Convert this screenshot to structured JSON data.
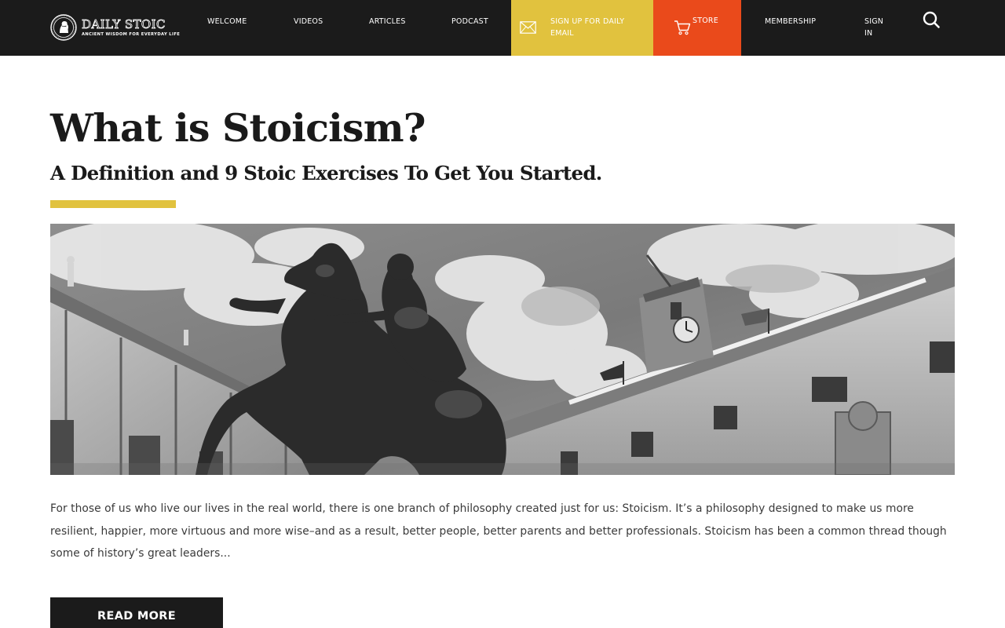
{
  "brand": {
    "name": "DAILY STOIC",
    "tagline": "ANCIENT WISDOM FOR EVERYDAY LIFE"
  },
  "nav": {
    "items": [
      {
        "label": "WELCOME"
      },
      {
        "label": "VIDEOS"
      },
      {
        "label": "ARTICLES"
      },
      {
        "label": "PODCAST"
      }
    ],
    "signup_label": "SIGN UP FOR DAILY EMAIL",
    "signup_icon": "envelope-icon",
    "store_label": "STORE",
    "store_icon": "cart-icon",
    "membership_label": "MEMBERSHIP",
    "signin_label": "SIGN IN",
    "search_icon": "search-icon"
  },
  "article": {
    "title": "What is Stoicism?",
    "subtitle": "A Definition and 9 Stoic Exercises To Get You Started.",
    "hero_image": "black-and-white photo of the Marcus Aurelius equestrian statue in front of a palazzo with a clock tower",
    "excerpt": "For those of us who live our lives in the real world, there is one branch of philosophy created just for us: Stoicism. It’s a philosophy designed to make us more resilient, happier, more virtuous and more wise–and as a result, better people, better parents and better professionals. Stoicism has been a common thread though some of history’s great leaders...",
    "read_more_label": "READ MORE"
  },
  "colors": {
    "nav_bg": "#1b1b1b",
    "signup_bg": "#e1c23e",
    "store_bg": "#ea4a1b",
    "accent": "#e1c23e",
    "text": "#1a1a1a"
  }
}
